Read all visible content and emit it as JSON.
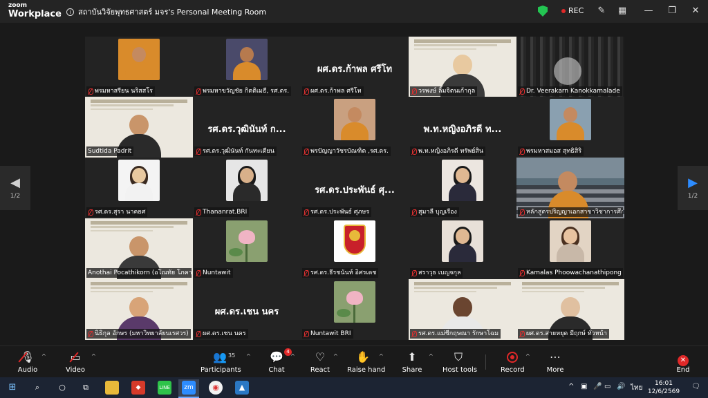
{
  "window": {
    "app_logo_line1": "zoom",
    "app_logo_line2": "Workplace",
    "meeting_title": "สถาบันวิจัยพุทธศาสตร์ มจร's Personal Meeting Room",
    "recording_label": "REC"
  },
  "participants": [
    {
      "name": "พรมหาสรียน นริสสโร",
      "type": "photo",
      "color": "#d98b2b",
      "skin": "#c48a60"
    },
    {
      "name": "พรมหาขวัญชัย กิตติเมธี, รศ.ดร.",
      "type": "photo",
      "color": "#4a4a6a",
      "skin": "#b67a4e",
      "robe": "#d98b2b"
    },
    {
      "name": "ผศ.ดร.ก้าพล ศรีโท",
      "type": "name",
      "display": "ผศ.ดร.ก้าพล ศรีโท"
    },
    {
      "name": "วรพงษ์ ลิ้มจิตนเก้ากุล",
      "type": "slide",
      "skin": "#e8c9a0",
      "shirt": "#3a3a3a",
      "muted": true
    },
    {
      "name": "Dr. Veerakarn Kanokkamalade",
      "type": "curtain"
    },
    {
      "name": "Sudtida Padrit",
      "type": "slide",
      "skin": "#c9956a",
      "shirt": "#2a2a2a",
      "active": true,
      "muted": false
    },
    {
      "name": "รศ.ดร.วุฒินันท์ กันทะเตียน",
      "type": "name",
      "display": "รศ.ดร.วุฒินันท์ ก..."
    },
    {
      "name": "พรปัญญาวัชรบัณฑิต ,รศ.ดร.",
      "type": "photo",
      "color": "#c9a080",
      "skin": "#c48a60",
      "robe": "#d98b2b"
    },
    {
      "name": "พ.ท.หญิงอภิรดี ทรัพย์สิน",
      "type": "name",
      "display": "พ.ท.หญิงอภิรดี ท..."
    },
    {
      "name": "พรมหาสมอส สุทธิสิริ",
      "type": "photo",
      "color": "#8aa0b0",
      "skin": "#c48a60",
      "robe": "#d98b2b"
    },
    {
      "name": "รศ.ดร.สุรา นาคยศ",
      "type": "photo",
      "color": "#f4f4f4",
      "skin": "#e8c9a0",
      "robe": "#f2f2f2",
      "hair": "#3a2a20"
    },
    {
      "name": "Thananrat.BRI",
      "type": "photo",
      "color": "#e6e6e6",
      "skin": "#d8b08a",
      "robe": "#2a2a2a",
      "hair": "#1a1a1a"
    },
    {
      "name": "รศ.ดร.ประพันธ์ ศุภษร",
      "type": "name",
      "display": "รศ.ดร.ประพันธ์ ศุ..."
    },
    {
      "name": "สุมาลี บุญเรือง",
      "type": "photo",
      "color": "#ece6e0",
      "skin": "#e0b892",
      "robe": "#2a2a3a",
      "hair": "#1a1a1a"
    },
    {
      "name": "หลักสูตรปริญญาเอกสาขาวิชาการศึกษาพระพุทธศาสนา",
      "type": "classroom"
    },
    {
      "name": "Anothai Pocathikorn (อโณทัย โภคาธิกรณ์)",
      "type": "slide",
      "skin": "#c9956a",
      "shirt": "#3a3a3a",
      "muted": false
    },
    {
      "name": "Nuntawit",
      "type": "lotus"
    },
    {
      "name": "รศ.ดร.ธีรชนันท์ อิศรเดช",
      "type": "emblem"
    },
    {
      "name": "สราวุธ เบญจกุล",
      "type": "photo",
      "color": "#e8e0d8",
      "skin": "#e0b892",
      "robe": "#2a2a3a",
      "hair": "#1a1a1a"
    },
    {
      "name": "Kamalas Phoowachanathipong",
      "type": "photo",
      "color": "#e2d4c4",
      "skin": "#e8c3a0",
      "robe": "#c8b8a8",
      "hair": "#4a3020"
    },
    {
      "name": "นิธิกุล อักษร (มหาวิทยาลัยนเรศวร)",
      "type": "slide",
      "skin": "#d8a478",
      "shirt": "#5a3a6a",
      "muted": true
    },
    {
      "name": "ผศ.ดร.เชน นคร",
      "type": "name",
      "display": "ผศ.ดร.เชน นคร"
    },
    {
      "name": "Nuntawit BRI",
      "type": "lotus"
    },
    {
      "name": "รศ.ดร.แม่ชีกฤษณา รักษาโฉม",
      "type": "slide",
      "skin": "#6a4530",
      "shirt": "#e8e8e8",
      "muted": true
    },
    {
      "name": "ผศ.ดร.สายหยุด มีฤกษ์ ทั่วหน้า",
      "type": "slide",
      "skin": "#e0c0a0",
      "shirt": "#2a2a2a",
      "muted": true
    }
  ],
  "pager": {
    "left": "1/2",
    "right": "1/2"
  },
  "toolbar": {
    "audio": "Audio",
    "video": "Video",
    "participants": "Participants",
    "participants_count": "35",
    "chat": "Chat",
    "chat_badge": "4",
    "react": "React",
    "raise_hand": "Raise hand",
    "share": "Share",
    "host_tools": "Host tools",
    "record": "Record",
    "more": "More",
    "end": "End"
  },
  "taskbar": {
    "lang": "ไทย",
    "time": "16:01",
    "date": "12/6/2569"
  }
}
